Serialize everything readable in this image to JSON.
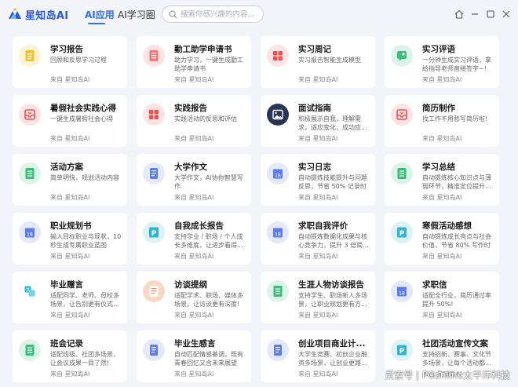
{
  "app": {
    "name": "星知岛AI"
  },
  "nav": {
    "tabs": [
      {
        "label": "AI应用",
        "active": true
      },
      {
        "label": "AI学习圈",
        "active": false
      }
    ]
  },
  "search": {
    "placeholder": "搜索你感兴趣的内容..."
  },
  "colors": {
    "accent": "#2f6ff0",
    "background": "#f3f4f9"
  },
  "cards": [
    {
      "title": "学习报告",
      "desc": "回顾和反思学习过程",
      "source": "来自 星知岛AI",
      "icon": "document-icon",
      "icon_bg": "#fdf3cf",
      "icon_fg": "#f1c232"
    },
    {
      "title": "勤工助学申请书",
      "desc": "助力学习，一键生成勤工助学申请书",
      "source": "来自 星知岛AI",
      "icon": "form-icon",
      "icon_bg": "#fde3e3",
      "icon_fg": "#f07a7a"
    },
    {
      "title": "实习周记",
      "desc": "实习报告智能生成模型",
      "source": "来自 星知岛AI",
      "icon": "puzzle-icon",
      "icon_bg": "#fde3e3",
      "icon_fg": "#e85353"
    },
    {
      "title": "实习评语",
      "desc": "一分钟生成实习评语，拿给指导老师直接签字~!",
      "source": "来自 星知岛AI",
      "icon": "comment-icon",
      "icon_bg": "#dcf3e7",
      "icon_fg": "#3bbd7c"
    },
    {
      "title": "暑假社会实践心得",
      "desc": "一键生成暑假社会心得",
      "source": "来自 星知岛AI",
      "icon": "inbox-icon",
      "icon_bg": "#fde3e3",
      "icon_fg": "#e85353"
    },
    {
      "title": "实践报告",
      "desc": "实践活动的反思和评估",
      "source": "来自 星知岛AI",
      "icon": "puzzle-icon",
      "icon_bg": "#fde3e3",
      "icon_fg": "#e85353"
    },
    {
      "title": "面试指南",
      "desc": "积极展示自我，理解需求，适应变化，成功应...",
      "source": "来自 星知岛AI",
      "icon": "image-icon",
      "icon_bg": "#2a3556",
      "icon_fg": "#ffffff"
    },
    {
      "title": "简历制作",
      "desc": "找工作不用愁写简历啦!",
      "source": "来自 星知岛AI",
      "icon": "inbox-icon",
      "icon_bg": "#fde3e3",
      "icon_fg": "#e85353"
    },
    {
      "title": "活动方案",
      "desc": "简单明快，规划活动内容",
      "source": "来自 星知岛AI",
      "icon": "list-icon",
      "icon_bg": "#dcf3e7",
      "icon_fg": "#3bbd7c"
    },
    {
      "title": "大学作文",
      "desc": "大学作文，AI协你智慧写作",
      "source": "来自 星知岛AI",
      "icon": "notes-icon",
      "icon_bg": "#e3e8fb",
      "icon_fg": "#5b7cf0"
    },
    {
      "title": "实习日志",
      "desc": "自动提炼技能提升与问题反思，节省 50% 记录时间",
      "source": "来自 星知岛AI",
      "icon": "calendar-icon",
      "icon_bg": "#e3e8fb",
      "icon_fg": "#5b7cf0"
    },
    {
      "title": "学习总结",
      "desc": "自动提炼核心知识点与薄弱环节，精准定位提升...",
      "source": "来自 星知岛AI",
      "icon": "list-icon",
      "icon_bg": "#dcf3e7",
      "icon_fg": "#3bbd7c"
    },
    {
      "title": "职业规划书",
      "desc": "输入目标职业与现状，10秒生成专属职业蓝图",
      "source": "来自 星知岛AI",
      "icon": "calendar-icon",
      "icon_bg": "#e3e8fb",
      "icon_fg": "#5b7cf0"
    },
    {
      "title": "自我成长报告",
      "desc": "支持学业 / 职场 / 个人成长多维度，让进步看得...",
      "source": "来自 星知岛AI",
      "icon": "p-icon",
      "icon_bg": "#def2f6",
      "icon_fg": "#31b6d2"
    },
    {
      "title": "求职自我评价",
      "desc": "自动提炼数据化成果与核心竞争力，提升 3 倍简...",
      "source": "来自 星知岛AI",
      "icon": "calendar-icon",
      "icon_bg": "#e3e8fb",
      "icon_fg": "#5b7cf0"
    },
    {
      "title": "寒假活动感想",
      "desc": "自动提炼成长亮点与社会价值，节省 80% 写作时间",
      "source": "来自 星知岛AI",
      "icon": "p-icon",
      "icon_bg": "#def2f6",
      "icon_fg": "#31b6d2"
    },
    {
      "title": "毕业赠言",
      "desc": "适配同学、老师、母校多场景，让告别更有仪式...",
      "source": "来自 星知岛AI",
      "icon": "translate-icon",
      "icon_bg": "#ffffff",
      "icon_fg": "#2bb7d6"
    },
    {
      "title": "访谈提纲",
      "desc": "适配学术、职场、媒体多场景，让访谈更有深度!",
      "source": "来自 星知岛AI",
      "icon": "script-icon",
      "icon_bg": "#fbd7c4",
      "icon_fg": "#f08a5a"
    },
    {
      "title": "生涯人物访谈报告",
      "desc": "支持学生、职场新人多场景，让职业规划更有方...",
      "source": "来自 星知岛AI",
      "icon": "list-icon",
      "icon_bg": "#dcf3e7",
      "icon_fg": "#3bbd7c"
    },
    {
      "title": "求职信",
      "desc": "适配全行业，简历通过率提升 50%!",
      "source": "来自 星知岛AI",
      "icon": "calendar-icon",
      "icon_bg": "#e3e8fb",
      "icon_fg": "#5b7cf0"
    },
    {
      "title": "班会记录",
      "desc": "适配班级、社团多场景，让会议成果一目了然!",
      "source": "来自 星知岛AI",
      "icon": "list-icon",
      "icon_bg": "#dcf3e7",
      "icon_fg": "#3bbd7c"
    },
    {
      "title": "毕业生感言",
      "desc": "自动匹配情感基调，既有青春回忆又含未来展望",
      "source": "来自 星知岛AI",
      "icon": "notes-icon",
      "icon_bg": "#e3e8fb",
      "icon_fg": "#5b7cf0"
    },
    {
      "title": "创业项目商业计...",
      "desc": "大学生竞赛、初创企业融资多场景，让创业更路...",
      "source": "来自 星知岛AI",
      "icon": "notes-icon",
      "icon_bg": "#e3e8fb",
      "icon_fg": "#5b7cf0"
    },
    {
      "title": "社团活动宣传文案",
      "desc": "支持招新、赛事、文化节多场景，让每个活动都...",
      "source": "来自 星知岛AI",
      "icon": "p-icon",
      "icon_bg": "#def2f6",
      "icon_fg": "#31b6d2"
    }
  ],
  "watermark": "灵索号 | PConline太平洋科技"
}
